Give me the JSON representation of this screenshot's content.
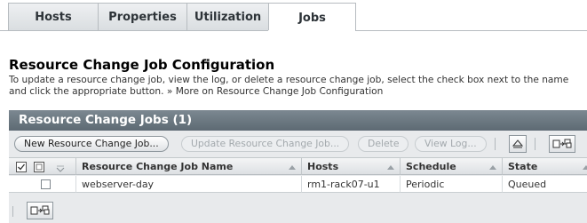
{
  "tabs": [
    {
      "label": "Hosts",
      "active": false
    },
    {
      "label": "Properties",
      "active": false
    },
    {
      "label": "Utilization",
      "active": false
    },
    {
      "label": "Jobs",
      "active": true
    }
  ],
  "page": {
    "title": "Resource Change Job Configuration",
    "help_line1": "To update a resource change job, view the log, or delete a resource change job, select the check box next to the name",
    "help_line2_prefix": "and click the appropriate button. »",
    "help_more_link": "More on Resource Change Job Configuration"
  },
  "table": {
    "title": "Resource Change Jobs (1)",
    "buttons": {
      "new": "New Resource Change Job...",
      "update": "Update Resource Change Job...",
      "delete": "Delete",
      "view_log": "View Log..."
    },
    "columns": {
      "name": "Resource Change Job Name",
      "hosts": "Hosts",
      "schedule": "Schedule",
      "state": "State"
    },
    "rows": [
      {
        "name": "webserver-day",
        "hosts": "rm1-rack07-u1",
        "schedule": "Periodic",
        "state": "Queued"
      }
    ]
  },
  "icons": [
    "select-all-icon",
    "deselect-all-icon",
    "sort-menu-icon",
    "collapse-up-icon",
    "preferences-icon"
  ]
}
